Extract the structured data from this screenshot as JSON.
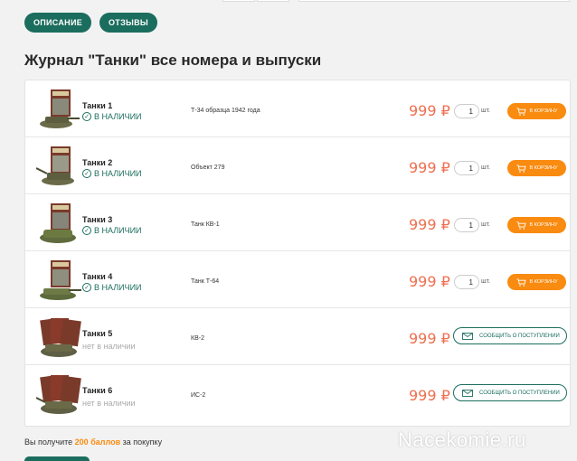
{
  "tabs": {
    "description": "ОПИСАНИЕ",
    "reviews": "ОТЗЫВЫ"
  },
  "page_title": "Журнал \"Танки\" все номера и выпуски",
  "colors": {
    "brand_green": "#1b6d5e",
    "price": "#ee6f50",
    "cart_orange": "#f98b10"
  },
  "products": [
    {
      "name": "Танки 1",
      "status": "В НАЛИЧИИ",
      "in_stock": true,
      "desc": "Т-34 образца 1942 года",
      "price": "999 ₽",
      "qty": "1",
      "unit": "шт.",
      "action": "В КОРЗИНУ"
    },
    {
      "name": "Танки 2",
      "status": "В НАЛИЧИИ",
      "in_stock": true,
      "desc": "Объект 279",
      "price": "999 ₽",
      "qty": "1",
      "unit": "шт.",
      "action": "В КОРЗИНУ"
    },
    {
      "name": "Танки 3",
      "status": "В НАЛИЧИИ",
      "in_stock": true,
      "desc": "Танк КВ-1",
      "price": "999 ₽",
      "qty": "1",
      "unit": "шт.",
      "action": "В КОРЗИНУ"
    },
    {
      "name": "Танки 4",
      "status": "В НАЛИЧИИ",
      "in_stock": true,
      "desc": "Танк Т-64",
      "price": "999 ₽",
      "qty": "1",
      "unit": "шт.",
      "action": "В КОРЗИНУ"
    },
    {
      "name": "Танки 5",
      "status": "нет в наличии",
      "in_stock": false,
      "desc": "КВ-2",
      "price": "999 ₽",
      "action": "СООБЩИТЬ О ПОСТУПЛЕНИИ"
    },
    {
      "name": "Танки 6",
      "status": "нет в наличии",
      "in_stock": false,
      "desc": "ИС-2",
      "price": "999 ₽",
      "action": "СООБЩИТЬ О ПОСТУПЛЕНИИ"
    }
  ],
  "bonus": {
    "prefix": "Вы получите",
    "points": "200 баллов",
    "suffix": "за покупку"
  },
  "watermark": "Nacekomie.ru"
}
